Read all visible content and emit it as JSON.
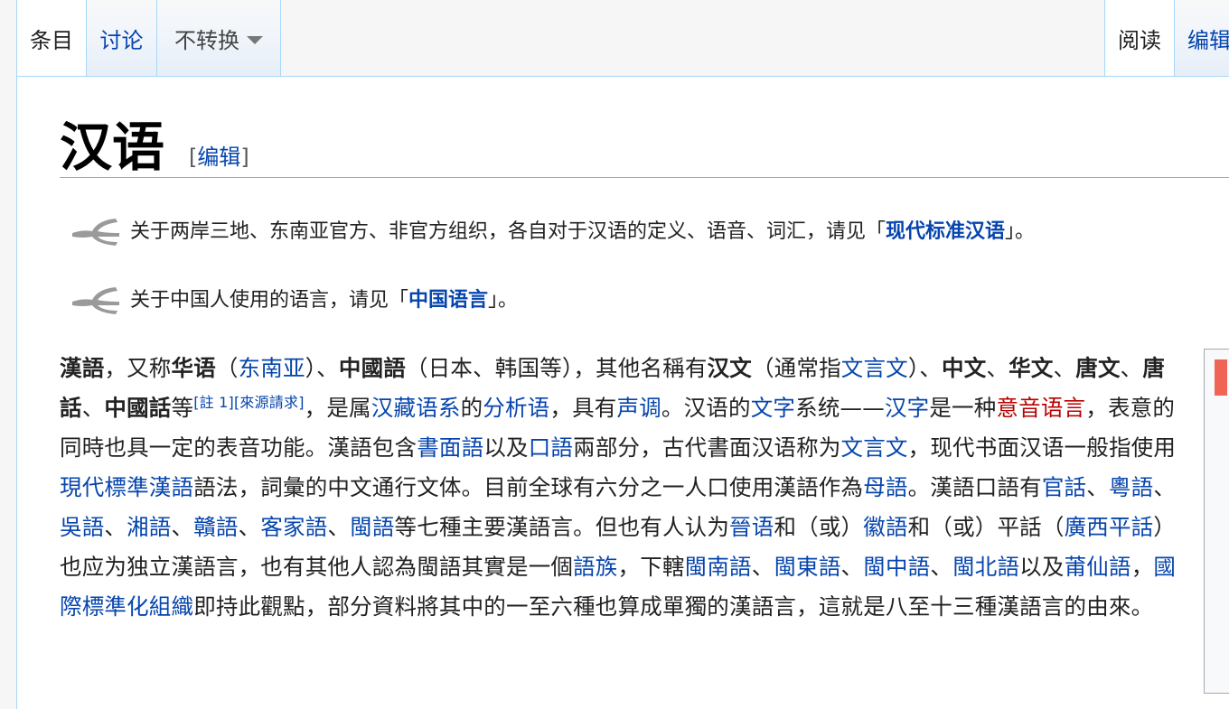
{
  "tabs_left": [
    {
      "label": "条目"
    },
    {
      "label": "讨论"
    },
    {
      "label": "不转换"
    }
  ],
  "tabs_right": [
    {
      "label": "阅读"
    },
    {
      "label": "编辑"
    }
  ],
  "title": "汉语",
  "edit_bracket_open": "[",
  "edit_label": "编辑",
  "edit_bracket_close": "]",
  "hatnotes": [
    {
      "prefix": "关于两岸三地、东南亚官方、非官方组织，各自对于汉语的定义、语音、词汇，请见「",
      "link": "现代标准汉语",
      "suffix": "」。"
    },
    {
      "prefix": "关于中国人使用的语言，请见「",
      "link": "中国语言",
      "suffix": "」。"
    }
  ],
  "paragraph": [
    {
      "t": "b",
      "v": "漢語"
    },
    {
      "t": "text",
      "v": "，又称"
    },
    {
      "t": "b",
      "v": "华语"
    },
    {
      "t": "text",
      "v": "（"
    },
    {
      "t": "link",
      "v": "东南亚"
    },
    {
      "t": "text",
      "v": "）、"
    },
    {
      "t": "b",
      "v": "中國語"
    },
    {
      "t": "text",
      "v": "（日本、韩国等），其他名稱有"
    },
    {
      "t": "b",
      "v": "汉文"
    },
    {
      "t": "text",
      "v": "（通常指"
    },
    {
      "t": "link",
      "v": "文言文"
    },
    {
      "t": "text",
      "v": "）、"
    },
    {
      "t": "b",
      "v": "中文"
    },
    {
      "t": "text",
      "v": "、"
    },
    {
      "t": "b",
      "v": "华文"
    },
    {
      "t": "text",
      "v": "、"
    },
    {
      "t": "b",
      "v": "唐文"
    },
    {
      "t": "text",
      "v": "、"
    },
    {
      "t": "b",
      "v": "唐話"
    },
    {
      "t": "text",
      "v": "、"
    },
    {
      "t": "b",
      "v": "中國話"
    },
    {
      "t": "text",
      "v": "等"
    },
    {
      "t": "sup",
      "v": "[註 1][來源請求]"
    },
    {
      "t": "text",
      "v": "，是属"
    },
    {
      "t": "link",
      "v": "汉藏语系"
    },
    {
      "t": "text",
      "v": "的"
    },
    {
      "t": "link",
      "v": "分析语"
    },
    {
      "t": "text",
      "v": "，具有"
    },
    {
      "t": "link",
      "v": "声调"
    },
    {
      "t": "text",
      "v": "。汉语的"
    },
    {
      "t": "link",
      "v": "文字"
    },
    {
      "t": "text",
      "v": "系统——"
    },
    {
      "t": "link",
      "v": "汉字"
    },
    {
      "t": "text",
      "v": "是一种"
    },
    {
      "t": "red",
      "v": "意音语言"
    },
    {
      "t": "text",
      "v": "，表意的同時也具一定的表音功能。漢語包含"
    },
    {
      "t": "link",
      "v": "書面語"
    },
    {
      "t": "text",
      "v": "以及"
    },
    {
      "t": "link",
      "v": "口語"
    },
    {
      "t": "text",
      "v": "兩部分，古代書面汉语称为"
    },
    {
      "t": "link",
      "v": "文言文"
    },
    {
      "t": "text",
      "v": "，现代书面汉语一般指使用"
    },
    {
      "t": "link",
      "v": "現代標準漢語"
    },
    {
      "t": "text",
      "v": "語法，詞彙的中文通行文体。目前全球有六分之一人口使用漢語作為"
    },
    {
      "t": "link",
      "v": "母語"
    },
    {
      "t": "text",
      "v": "。漢語口語有"
    },
    {
      "t": "link",
      "v": "官話"
    },
    {
      "t": "text",
      "v": "、"
    },
    {
      "t": "link",
      "v": "粵語"
    },
    {
      "t": "text",
      "v": "、"
    },
    {
      "t": "link",
      "v": "吳語"
    },
    {
      "t": "text",
      "v": "、"
    },
    {
      "t": "link",
      "v": "湘語"
    },
    {
      "t": "text",
      "v": "、"
    },
    {
      "t": "link",
      "v": "贛語"
    },
    {
      "t": "text",
      "v": "、"
    },
    {
      "t": "link",
      "v": "客家語"
    },
    {
      "t": "text",
      "v": "、"
    },
    {
      "t": "link",
      "v": "閩語"
    },
    {
      "t": "text",
      "v": "等七種主要漢語言。但也有人认为"
    },
    {
      "t": "link",
      "v": "晉语"
    },
    {
      "t": "text",
      "v": "和（或）"
    },
    {
      "t": "link",
      "v": "徽語"
    },
    {
      "t": "text",
      "v": "和（或）平話（"
    },
    {
      "t": "link",
      "v": "廣西平話"
    },
    {
      "t": "text",
      "v": "）也应为独立漢語言，也有其他人認為閩語其實是一個"
    },
    {
      "t": "link",
      "v": "語族"
    },
    {
      "t": "text",
      "v": "，下轄"
    },
    {
      "t": "link",
      "v": "閩南語"
    },
    {
      "t": "text",
      "v": "、"
    },
    {
      "t": "link",
      "v": "閩東語"
    },
    {
      "t": "text",
      "v": "、"
    },
    {
      "t": "link",
      "v": "閩中語"
    },
    {
      "t": "text",
      "v": "、"
    },
    {
      "t": "link",
      "v": "閩北語"
    },
    {
      "t": "text",
      "v": "以及"
    },
    {
      "t": "link",
      "v": "莆仙語"
    },
    {
      "t": "text",
      "v": "，"
    },
    {
      "t": "link",
      "v": "國際標準化組織"
    },
    {
      "t": "text",
      "v": "即持此觀點，部分資料將其中的一至六種也算成單獨的漢語言，這就是八至十三種漢語言的由來。"
    }
  ]
}
